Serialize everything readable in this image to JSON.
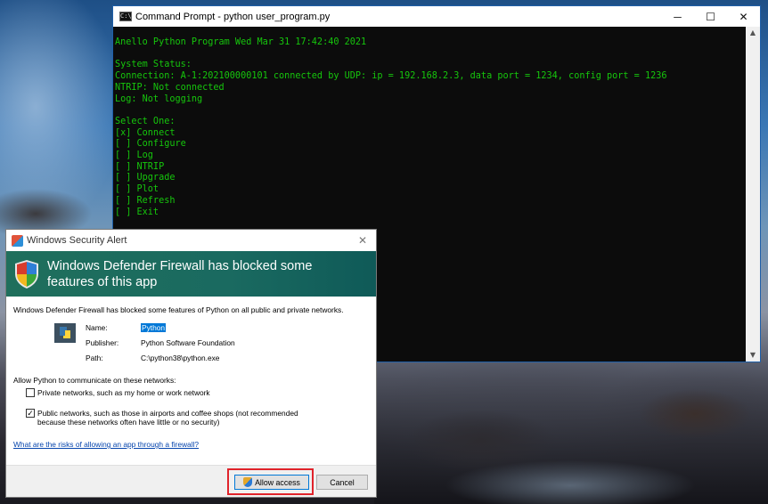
{
  "cmd": {
    "title": "Command Prompt - python  user_program.py",
    "icon_text": "C:\\",
    "controls": {
      "minimize": "─",
      "maximize": "☐",
      "close": "✕"
    },
    "lines": [
      "Anello Python Program Wed Mar 31 17:42:40 2021",
      "",
      "System Status:",
      "Connection: A-1:202100000101 connected by UDP: ip = 192.168.2.3, data port = 1234, config port = 1236",
      "NTRIP: Not connected",
      "Log: Not logging",
      "",
      "Select One:",
      "[x] Connect",
      "[ ] Configure",
      "[ ] Log",
      "[ ] NTRIP",
      "[ ] Upgrade",
      "[ ] Plot",
      "[ ] Refresh",
      "[ ] Exit"
    ],
    "scroll_up": "▲",
    "scroll_down": "▼"
  },
  "dialog": {
    "title": "Windows Security Alert",
    "close": "✕",
    "banner": "Windows Defender Firewall has blocked some features of this app",
    "message": "Windows Defender Firewall has blocked some features of Python on all public and private networks.",
    "info": {
      "name_label": "Name:",
      "name_value": "Python",
      "publisher_label": "Publisher:",
      "publisher_value": "Python Software Foundation",
      "path_label": "Path:",
      "path_value": "C:\\python38\\python.exe"
    },
    "allow_title": "Allow Python to communicate on these networks:",
    "private": {
      "label": "Private networks, such as my home or work network",
      "checked": false
    },
    "public": {
      "label": "Public networks, such as those in airports and coffee shops (not recommended because these networks often have little or no security)",
      "checked": true,
      "check_glyph": "✓"
    },
    "risk_link": "What are the risks of allowing an app through a firewall?",
    "allow_button": "Allow access",
    "cancel_button": "Cancel"
  },
  "colors": {
    "terminal_text": "#16c60c",
    "banner": "#1f6f5c",
    "highlight": "#e0232b"
  }
}
